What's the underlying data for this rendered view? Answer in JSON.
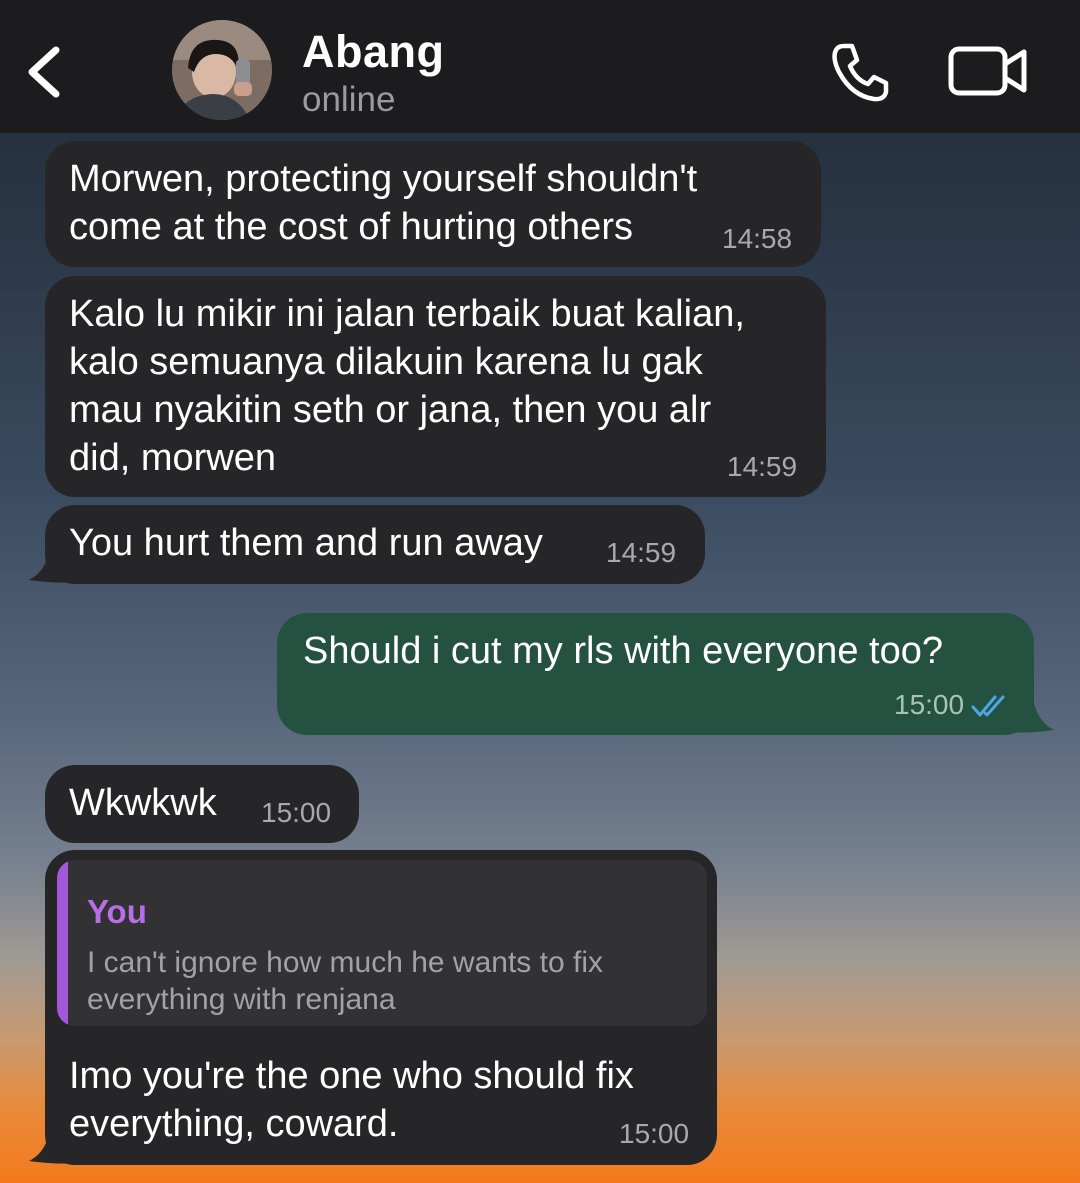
{
  "header": {
    "contact_name": "Abang",
    "status": "online"
  },
  "messages": [
    {
      "direction": "incoming",
      "lines": [
        "Morwen, protecting yourself shouldn't",
        "come at the cost of hurting others"
      ],
      "time": "14:58"
    },
    {
      "direction": "incoming",
      "lines": [
        "Kalo lu mikir ini jalan terbaik buat kalian,",
        "kalo semuanya dilakuin karena lu gak",
        "mau nyakitin seth or jana, then you alr",
        "did, morwen"
      ],
      "time": "14:59"
    },
    {
      "direction": "incoming",
      "lines": [
        "You hurt them and run away"
      ],
      "time": "14:59"
    },
    {
      "direction": "outgoing",
      "lines": [
        "Should i cut my rls with everyone too?"
      ],
      "time": "15:00",
      "status": "read"
    },
    {
      "direction": "incoming",
      "lines": [
        "Wkwkwk"
      ],
      "time": "15:00"
    },
    {
      "direction": "incoming",
      "reply_to": {
        "author": "You",
        "lines": [
          "I can't ignore how much he wants to fix",
          "everything with renjana"
        ]
      },
      "lines": [
        "Imo you're the one who should fix",
        "everything, coward."
      ],
      "time": "15:00"
    }
  ],
  "colors": {
    "header_bg": "#1c1c1e",
    "incoming_bubble": "#262628",
    "outgoing_bubble": "#245140",
    "reply_accent": "#a259d9",
    "read_receipt": "#4ea6e8"
  },
  "icons": {
    "back": "chevron-left-icon",
    "call": "phone-icon",
    "video": "video-camera-icon",
    "read": "double-check-icon"
  }
}
